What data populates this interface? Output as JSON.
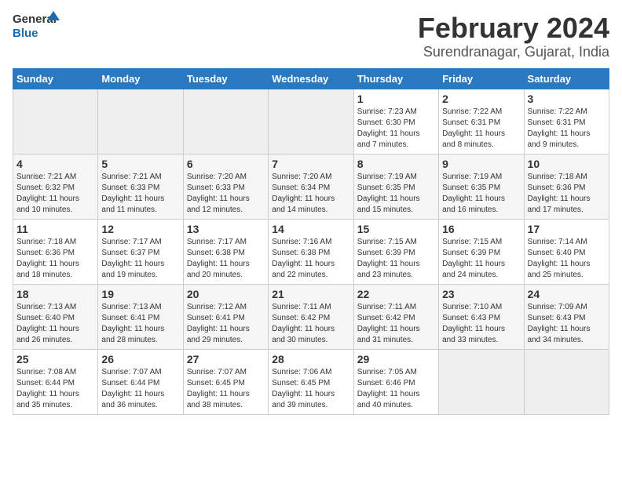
{
  "header": {
    "logo_line1": "General",
    "logo_line2": "Blue",
    "title": "February 2024",
    "subtitle": "Surendranagar, Gujarat, India"
  },
  "days_of_week": [
    "Sunday",
    "Monday",
    "Tuesday",
    "Wednesday",
    "Thursday",
    "Friday",
    "Saturday"
  ],
  "weeks": [
    [
      {
        "day": "",
        "info": ""
      },
      {
        "day": "",
        "info": ""
      },
      {
        "day": "",
        "info": ""
      },
      {
        "day": "",
        "info": ""
      },
      {
        "day": "1",
        "info": "Sunrise: 7:23 AM\nSunset: 6:30 PM\nDaylight: 11 hours\nand 7 minutes."
      },
      {
        "day": "2",
        "info": "Sunrise: 7:22 AM\nSunset: 6:31 PM\nDaylight: 11 hours\nand 8 minutes."
      },
      {
        "day": "3",
        "info": "Sunrise: 7:22 AM\nSunset: 6:31 PM\nDaylight: 11 hours\nand 9 minutes."
      }
    ],
    [
      {
        "day": "4",
        "info": "Sunrise: 7:21 AM\nSunset: 6:32 PM\nDaylight: 11 hours\nand 10 minutes."
      },
      {
        "day": "5",
        "info": "Sunrise: 7:21 AM\nSunset: 6:33 PM\nDaylight: 11 hours\nand 11 minutes."
      },
      {
        "day": "6",
        "info": "Sunrise: 7:20 AM\nSunset: 6:33 PM\nDaylight: 11 hours\nand 12 minutes."
      },
      {
        "day": "7",
        "info": "Sunrise: 7:20 AM\nSunset: 6:34 PM\nDaylight: 11 hours\nand 14 minutes."
      },
      {
        "day": "8",
        "info": "Sunrise: 7:19 AM\nSunset: 6:35 PM\nDaylight: 11 hours\nand 15 minutes."
      },
      {
        "day": "9",
        "info": "Sunrise: 7:19 AM\nSunset: 6:35 PM\nDaylight: 11 hours\nand 16 minutes."
      },
      {
        "day": "10",
        "info": "Sunrise: 7:18 AM\nSunset: 6:36 PM\nDaylight: 11 hours\nand 17 minutes."
      }
    ],
    [
      {
        "day": "11",
        "info": "Sunrise: 7:18 AM\nSunset: 6:36 PM\nDaylight: 11 hours\nand 18 minutes."
      },
      {
        "day": "12",
        "info": "Sunrise: 7:17 AM\nSunset: 6:37 PM\nDaylight: 11 hours\nand 19 minutes."
      },
      {
        "day": "13",
        "info": "Sunrise: 7:17 AM\nSunset: 6:38 PM\nDaylight: 11 hours\nand 20 minutes."
      },
      {
        "day": "14",
        "info": "Sunrise: 7:16 AM\nSunset: 6:38 PM\nDaylight: 11 hours\nand 22 minutes."
      },
      {
        "day": "15",
        "info": "Sunrise: 7:15 AM\nSunset: 6:39 PM\nDaylight: 11 hours\nand 23 minutes."
      },
      {
        "day": "16",
        "info": "Sunrise: 7:15 AM\nSunset: 6:39 PM\nDaylight: 11 hours\nand 24 minutes."
      },
      {
        "day": "17",
        "info": "Sunrise: 7:14 AM\nSunset: 6:40 PM\nDaylight: 11 hours\nand 25 minutes."
      }
    ],
    [
      {
        "day": "18",
        "info": "Sunrise: 7:13 AM\nSunset: 6:40 PM\nDaylight: 11 hours\nand 26 minutes."
      },
      {
        "day": "19",
        "info": "Sunrise: 7:13 AM\nSunset: 6:41 PM\nDaylight: 11 hours\nand 28 minutes."
      },
      {
        "day": "20",
        "info": "Sunrise: 7:12 AM\nSunset: 6:41 PM\nDaylight: 11 hours\nand 29 minutes."
      },
      {
        "day": "21",
        "info": "Sunrise: 7:11 AM\nSunset: 6:42 PM\nDaylight: 11 hours\nand 30 minutes."
      },
      {
        "day": "22",
        "info": "Sunrise: 7:11 AM\nSunset: 6:42 PM\nDaylight: 11 hours\nand 31 minutes."
      },
      {
        "day": "23",
        "info": "Sunrise: 7:10 AM\nSunset: 6:43 PM\nDaylight: 11 hours\nand 33 minutes."
      },
      {
        "day": "24",
        "info": "Sunrise: 7:09 AM\nSunset: 6:43 PM\nDaylight: 11 hours\nand 34 minutes."
      }
    ],
    [
      {
        "day": "25",
        "info": "Sunrise: 7:08 AM\nSunset: 6:44 PM\nDaylight: 11 hours\nand 35 minutes."
      },
      {
        "day": "26",
        "info": "Sunrise: 7:07 AM\nSunset: 6:44 PM\nDaylight: 11 hours\nand 36 minutes."
      },
      {
        "day": "27",
        "info": "Sunrise: 7:07 AM\nSunset: 6:45 PM\nDaylight: 11 hours\nand 38 minutes."
      },
      {
        "day": "28",
        "info": "Sunrise: 7:06 AM\nSunset: 6:45 PM\nDaylight: 11 hours\nand 39 minutes."
      },
      {
        "day": "29",
        "info": "Sunrise: 7:05 AM\nSunset: 6:46 PM\nDaylight: 11 hours\nand 40 minutes."
      },
      {
        "day": "",
        "info": ""
      },
      {
        "day": "",
        "info": ""
      }
    ]
  ]
}
